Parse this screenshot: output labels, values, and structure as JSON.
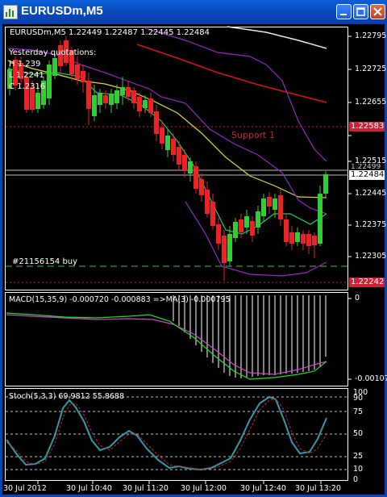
{
  "window": {
    "title": "EURUSDm,M5",
    "icon": "chart-window-icon",
    "buttons": [
      "minimize-icon",
      "maximize-icon",
      "close-icon"
    ]
  },
  "main_chart": {
    "header": "EURUSDm,M5  1.22449 1.22487 1.22445 1.22484",
    "yesterday": [
      "Yesterday quotations:",
      "H 1.239",
      "L 1.2241",
      "C 1.2316"
    ],
    "support_label": "Support 1",
    "order_label": "#21156154 buy",
    "price_axis": [
      "1.22795",
      "1.22725",
      "1.22655",
      "1.22585",
      "1.22515",
      "1.22445",
      "1.22375",
      "1.22305",
      "1.22235"
    ],
    "marker_support": "1.22583",
    "marker_bid": "1.22484",
    "marker_ask_partial": "1.22499",
    "marker_order": "1.22242",
    "colors": {
      "support_marker_bg": "#cc2233",
      "order_marker_bg": "#cc2233",
      "bull": "#33cc33",
      "bear": "#ee2222"
    }
  },
  "macd": {
    "label": "MACD(15,35,9) -0.000720 -0.000883  =>MA(3) -0.000795",
    "axis_top": "0",
    "axis_bottom": "-0.00107"
  },
  "stoch": {
    "label": "Stoch(5,3,3) 69.9812 55.8688",
    "axis": [
      "100",
      "90",
      "75",
      "50",
      "25",
      "10",
      "0"
    ]
  },
  "time_axis": [
    "30 Jul 2012",
    "30 Jul 10:40",
    "30 Jul 11:20",
    "30 Jul 12:00",
    "30 Jul 12:40",
    "30 Jul 13:20"
  ]
}
